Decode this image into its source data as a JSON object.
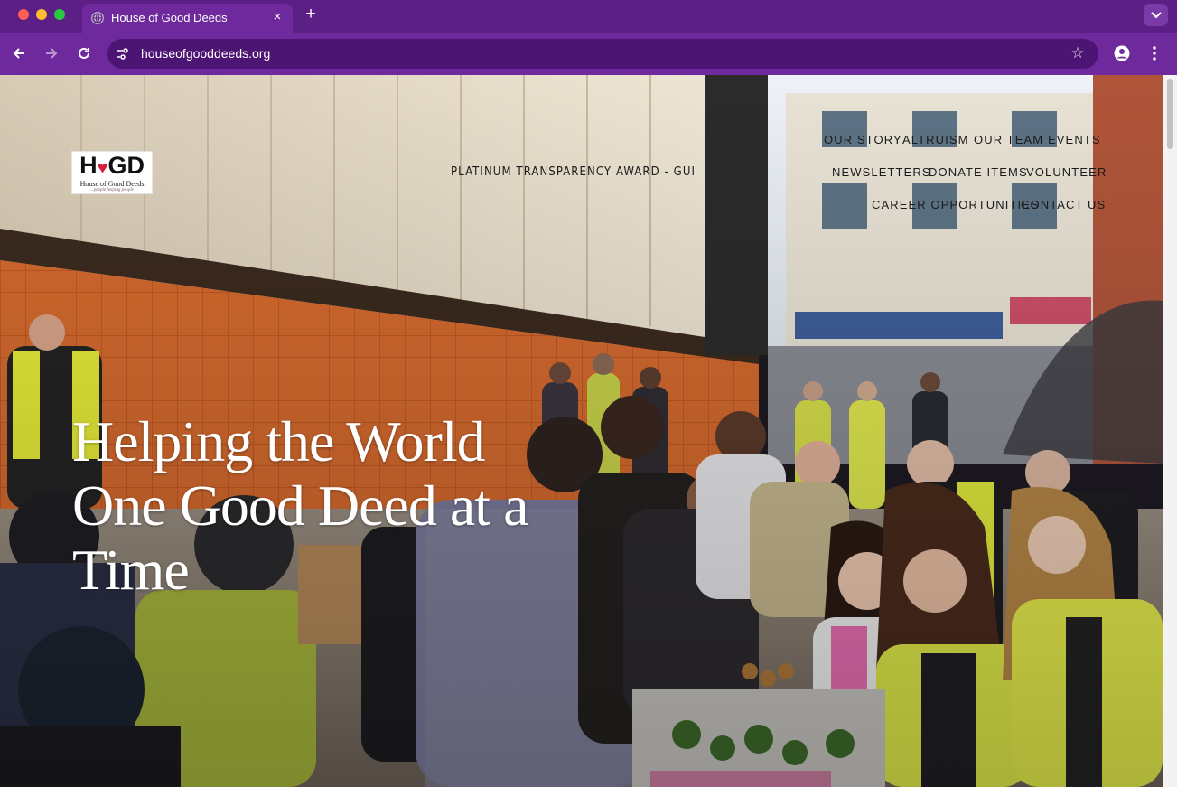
{
  "browser": {
    "tab_title": "House of Good Deeds",
    "tab_close_glyph": "×",
    "new_tab_glyph": "+",
    "url": "houseofgooddeeds.org",
    "star_glyph": "☆",
    "icons": [
      "globe-icon",
      "close-icon",
      "plus-icon",
      "chevron-down-icon",
      "back-arrow-icon",
      "forward-arrow-icon",
      "reload-icon",
      "site-settings-icon",
      "bookmark-star-icon",
      "profile-icon",
      "more-menu-icon"
    ]
  },
  "site": {
    "logo": {
      "mark_left": "H",
      "mark_heart": "♥",
      "mark_right": "GD",
      "name": "House of Good Deeds",
      "tagline": "...people helping people"
    },
    "award_link": "PLATINUM TRANSPARENCY AWARD - GUIDESTAR",
    "nav": {
      "our_story": "OUR STORY",
      "altruism": "ALTRUISM",
      "our_team": "OUR TEAM",
      "events": "EVENTS",
      "newsletters": "NEWSLETTERS",
      "donate_items": "DONATE ITEMS",
      "volunteer": "VOLUNTEER",
      "career_opportunities": "CAREER OPPORTUNITIES",
      "contact_us": "CONTACT US"
    },
    "hero": {
      "line1": "Helping the World",
      "line2": "One Good Deed at a",
      "line3": "Time"
    }
  },
  "colors": {
    "tabbar": "#5c1f86",
    "toolbar": "#6e2a9c",
    "omnibox": "#4d1573",
    "heart": "#d4213a",
    "nav_text": "#1b1b1b",
    "headline": "#ffffff"
  }
}
